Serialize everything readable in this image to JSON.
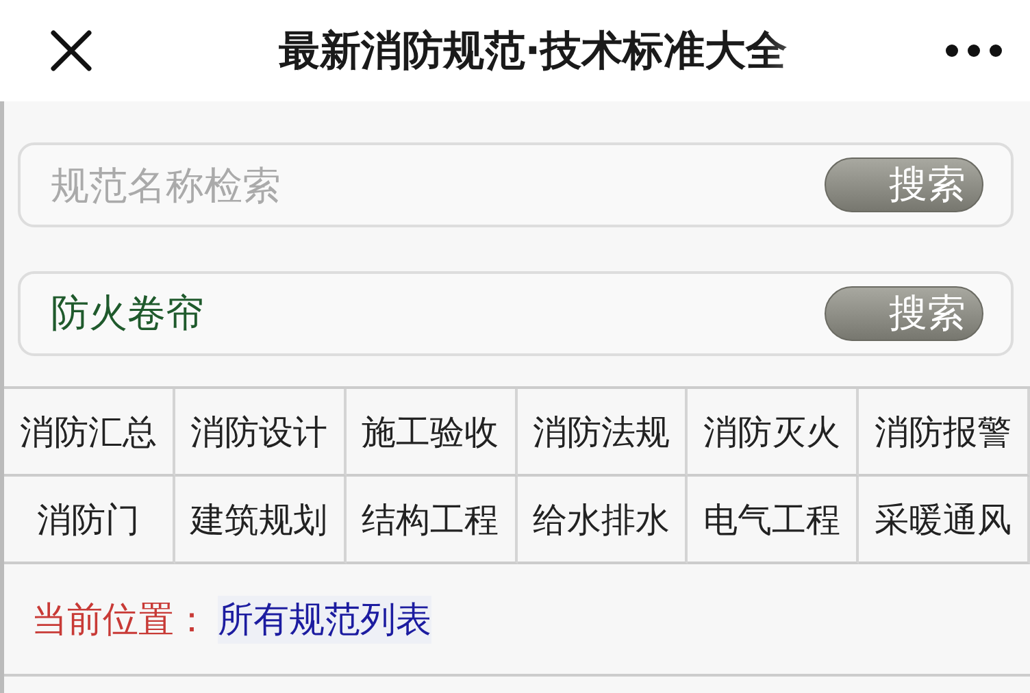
{
  "header": {
    "title": "最新消防规范·技术标准大全"
  },
  "search_fields": [
    {
      "placeholder": "规范名称检索",
      "button": "搜索"
    },
    {
      "value": "防火卷帘",
      "button": "搜索"
    }
  ],
  "categories": [
    {
      "label": "消防汇总"
    },
    {
      "label": "消防设计"
    },
    {
      "label": "施工验收"
    },
    {
      "label": "消防法规"
    },
    {
      "label": "消防灭火"
    },
    {
      "label": "消防报警"
    },
    {
      "label": "消防门"
    },
    {
      "label": "建筑规划"
    },
    {
      "label": "结构工程"
    },
    {
      "label": "给水排水"
    },
    {
      "label": "电气工程"
    },
    {
      "label": "采暖通风"
    }
  ],
  "breadcrumb": {
    "label": "当前位置：",
    "location": "所有规范列表"
  }
}
